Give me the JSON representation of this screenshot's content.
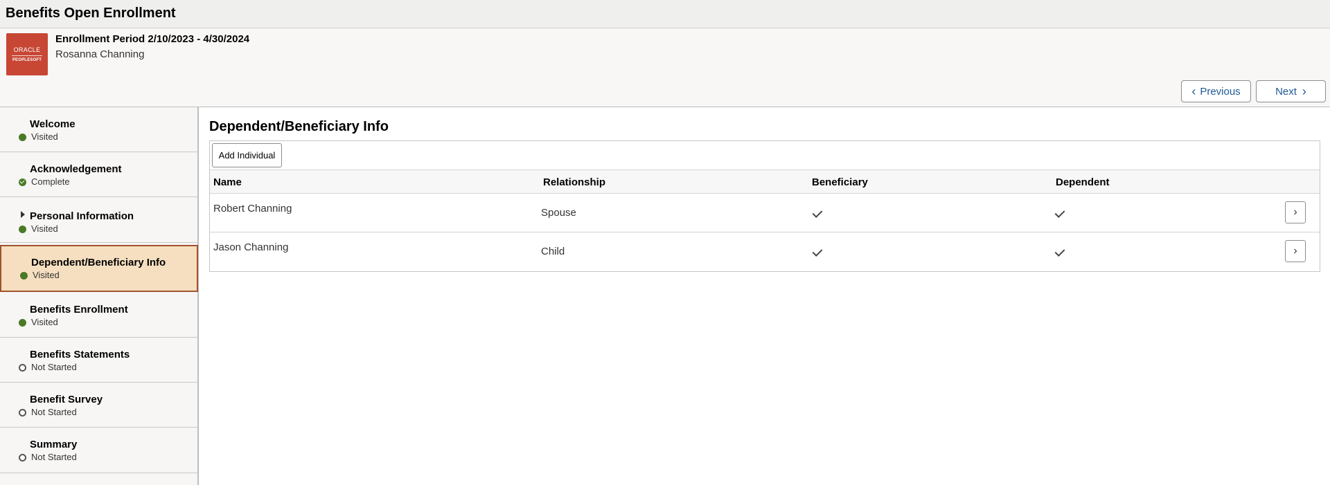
{
  "page": {
    "title": "Benefits Open Enrollment"
  },
  "header": {
    "logo": {
      "line1": "ORACLE",
      "line2": "PEOPLESOFT"
    },
    "period": "Enrollment Period 2/10/2023 - 4/30/2024",
    "person": "Rosanna Channing",
    "previous_label": "Previous",
    "next_label": "Next"
  },
  "sidebar": {
    "items": [
      {
        "label": "Welcome",
        "status": "Visited"
      },
      {
        "label": "Acknowledgement",
        "status": "Complete"
      },
      {
        "label": "Personal Information",
        "status": "Visited"
      },
      {
        "label": "Dependent/Beneficiary Info",
        "status": "Visited"
      },
      {
        "label": "Benefits Enrollment",
        "status": "Visited"
      },
      {
        "label": "Benefits Statements",
        "status": "Not Started"
      },
      {
        "label": "Benefit Survey",
        "status": "Not Started"
      },
      {
        "label": "Summary",
        "status": "Not Started"
      }
    ]
  },
  "main": {
    "section_title": "Dependent/Beneficiary Info",
    "add_label": "Add Individual",
    "columns": {
      "name": "Name",
      "relationship": "Relationship",
      "beneficiary": "Beneficiary",
      "dependent": "Dependent"
    },
    "rows": [
      {
        "name": "Robert Channing",
        "relationship": "Spouse",
        "beneficiary": true,
        "dependent": true
      },
      {
        "name": "Jason Channing",
        "relationship": "Child",
        "beneficiary": true,
        "dependent": true
      }
    ]
  },
  "colors": {
    "accent": "#1e5a96",
    "status_green": "#4a7a26",
    "active_bg": "#f6dfc0",
    "active_border": "#a0522d",
    "logo_red": "#c74634"
  }
}
